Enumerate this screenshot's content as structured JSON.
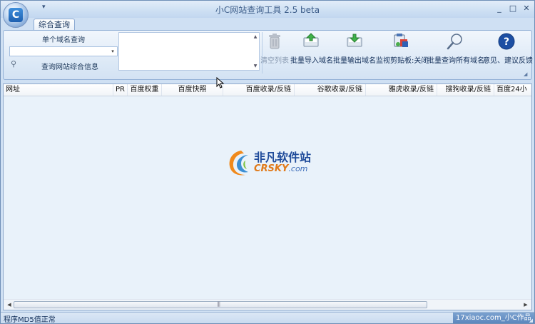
{
  "window": {
    "title": "小C网站查询工具 2.5 beta",
    "app_icon_letter": "C",
    "qat_arrow": "▾",
    "controls": {
      "minimize": "_",
      "maximize": "□",
      "close": "✕"
    }
  },
  "ribbon": {
    "tabs": [
      {
        "label": "综合查询",
        "active": true
      }
    ],
    "domain_group": {
      "label": "单个域名查询",
      "combo_value": "",
      "combo_arrow": "▾",
      "query_info_label": "查询网站综合信息"
    },
    "textarea": {
      "value": "",
      "scroll_up": "▲",
      "scroll_down": "▼"
    },
    "buttons": [
      {
        "label": "清空列表",
        "icon": "trash-icon",
        "enabled": false
      },
      {
        "label": "批量导入域名",
        "icon": "import-icon",
        "enabled": true
      },
      {
        "label": "批量输出域名",
        "icon": "export-icon",
        "enabled": true
      },
      {
        "label": "监视剪贴板:关闭",
        "icon": "clipboard-monitor-icon",
        "enabled": true
      },
      {
        "label": "批量查询所有域名",
        "icon": "magnifier-icon",
        "enabled": true
      },
      {
        "label": "意见、建议反馈",
        "icon": "help-icon",
        "enabled": true
      }
    ]
  },
  "list": {
    "columns": [
      "网址",
      "PR",
      "百度权重",
      "百度快照",
      "百度收录/反链",
      "谷歌收录/反链",
      "雅虎收录/反链",
      "搜狗收录/反链",
      "百度24小"
    ],
    "rows": []
  },
  "watermark": {
    "cn": "非凡软件站",
    "en": "CRSKY",
    "domain": ".com"
  },
  "statusbar": {
    "left": "程序MD5值正常",
    "right": "17xiaoc.com_小C作品"
  },
  "colors": {
    "accent": "#1d5fb0",
    "list_bg": "#e9f2fa",
    "status_right_bg": "#5d87bd",
    "watermark_orange": "#e07a1a",
    "watermark_blue": "#1f4b9a"
  }
}
